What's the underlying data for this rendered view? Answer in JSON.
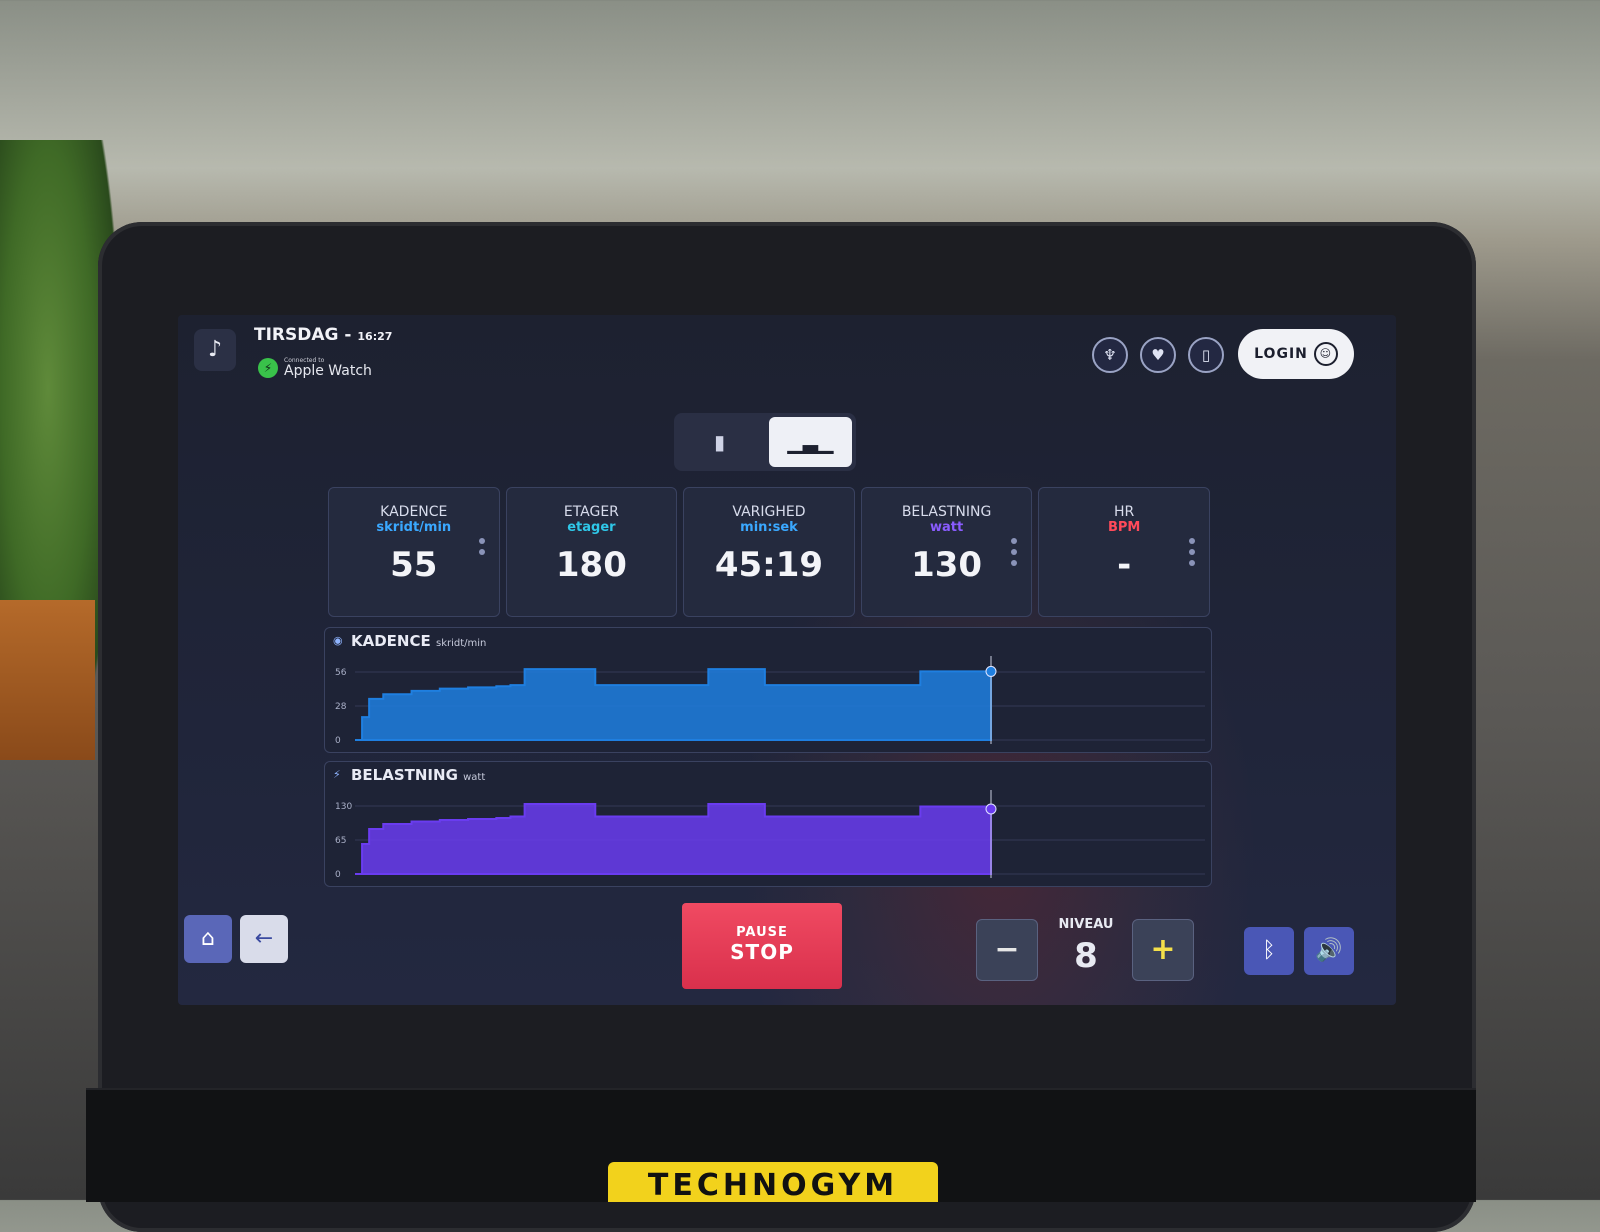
{
  "header": {
    "day": "TIRSDAG",
    "separator": " - ",
    "time": "16:27",
    "device_prefix": "Connected to",
    "device_name": "Apple Watch",
    "login_label": "LOGIN"
  },
  "icons": {
    "music": "music-note-icon",
    "stats": "trophy-icon",
    "heart": "heart-icon",
    "phone": "phone-icon",
    "user": "user-circle-icon",
    "view_carousel": "carousel-icon",
    "view_chart": "bar-chart-icon",
    "home": "home-icon",
    "back": "back-arrow-icon",
    "bluetooth": "bluetooth-icon",
    "volume": "volume-icon"
  },
  "metrics": [
    {
      "label": "KADENCE",
      "unit": "skridt/min",
      "value": "55",
      "unit_color": "#3aa8ff"
    },
    {
      "label": "ETAGER",
      "unit": "etager",
      "value": "180",
      "unit_color": "#2fc7e8"
    },
    {
      "label": "VARIGHED",
      "unit": "min:sek",
      "value": "45:19",
      "unit_color": "#3aa8ff"
    },
    {
      "label": "BELASTNING",
      "unit": "watt",
      "value": "130",
      "unit_color": "#8a5cff"
    },
    {
      "label": "HR",
      "unit": "BPM",
      "value": "-",
      "unit_color": "#ff4a5a"
    }
  ],
  "chart_data": [
    {
      "type": "area",
      "title": "KADENCE",
      "unit": "skridt/min",
      "color": "#1f7fe0",
      "y_ticks": [
        "0",
        "28",
        "56"
      ],
      "ylim": [
        0,
        70
      ],
      "x": [
        0,
        0.5,
        1,
        2,
        4,
        6,
        8,
        10,
        11,
        12,
        13,
        14,
        15,
        16,
        17,
        18,
        19,
        20,
        21,
        22,
        23,
        24,
        25,
        26,
        27,
        28,
        29,
        30,
        31,
        32,
        33,
        34,
        35,
        36,
        37,
        38,
        39,
        40,
        41,
        42,
        43,
        44,
        45
      ],
      "values": [
        0,
        20,
        36,
        40,
        43,
        45,
        46,
        47,
        48,
        62,
        62,
        62,
        62,
        62,
        48,
        48,
        48,
        48,
        48,
        48,
        48,
        48,
        62,
        62,
        62,
        62,
        48,
        48,
        48,
        48,
        48,
        48,
        48,
        48,
        48,
        48,
        48,
        60,
        60,
        60,
        60,
        60,
        60
      ]
    },
    {
      "type": "area",
      "title": "BELASTNING",
      "unit": "watt",
      "color": "#6a3cf0",
      "y_ticks": [
        "0",
        "65",
        "130"
      ],
      "ylim": [
        0,
        160
      ],
      "x": [
        0,
        0.5,
        1,
        2,
        4,
        6,
        8,
        10,
        11,
        12,
        13,
        14,
        15,
        16,
        17,
        18,
        19,
        20,
        21,
        22,
        23,
        24,
        25,
        26,
        27,
        28,
        29,
        30,
        31,
        32,
        33,
        34,
        35,
        36,
        37,
        38,
        39,
        40,
        41,
        42,
        43,
        44,
        45
      ],
      "values": [
        0,
        60,
        90,
        100,
        105,
        108,
        110,
        112,
        115,
        140,
        140,
        140,
        140,
        140,
        115,
        115,
        115,
        115,
        115,
        115,
        115,
        115,
        140,
        140,
        140,
        140,
        115,
        115,
        115,
        115,
        115,
        115,
        115,
        115,
        115,
        115,
        115,
        135,
        135,
        135,
        135,
        135,
        130
      ]
    }
  ],
  "controls": {
    "pause_label": "PAUSE",
    "stop_label": "STOP",
    "minus_label": "−",
    "plus_label": "+",
    "niveau_label": "NIVEAU",
    "niveau_value": "8"
  },
  "brand": "TECHNOGYM"
}
